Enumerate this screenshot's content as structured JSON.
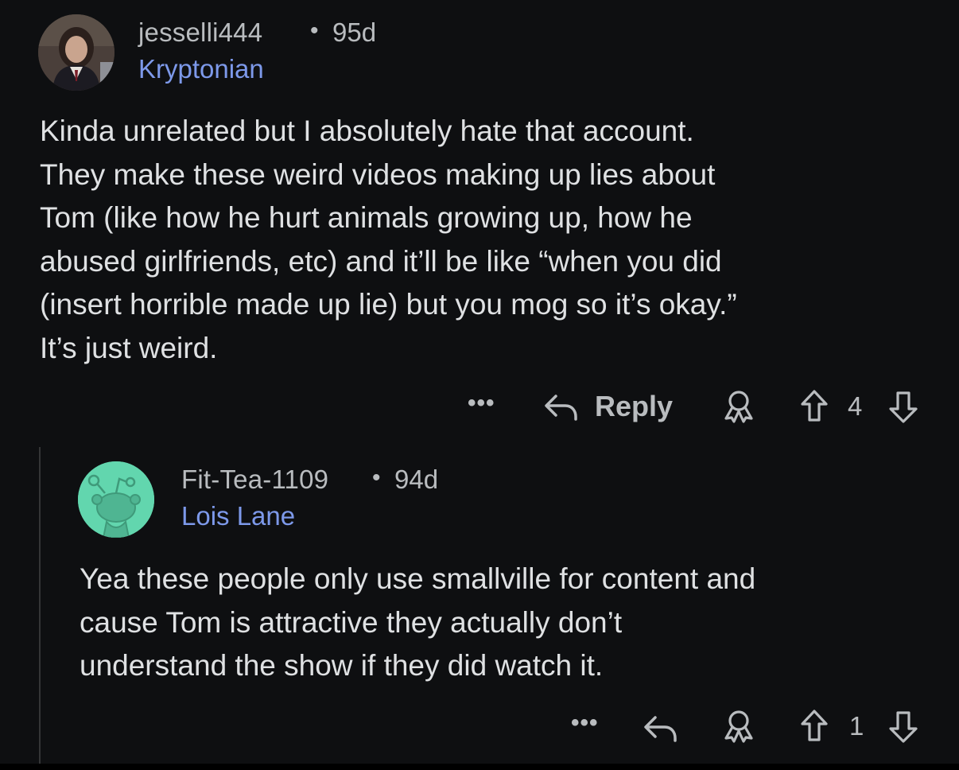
{
  "comments": [
    {
      "username": "jesselli444",
      "separator": "•",
      "age": "95d",
      "flair": "Kryptonian",
      "avatar_icon": "user-photo-avatar",
      "body_lines": [
        "Kinda unrelated but I absolutely hate that account.",
        "They make these weird videos making up lies about",
        "Tom (like how he hurt animals growing up, how he",
        "abused girlfriends, etc) and it’ll be like “when you did",
        "(insert horrible made up lie) but you mog so it’s okay.”",
        "It’s just weird."
      ],
      "actions": {
        "more_label": "•••",
        "reply_label": "Reply",
        "score": "4"
      }
    },
    {
      "username": "Fit-Tea-1109",
      "separator": "•",
      "age": "94d",
      "flair": "Lois Lane",
      "avatar_icon": "snoo-avatar",
      "avatar_color": "#62d6ae",
      "body_lines": [
        "Yea these people only use smallville for content and",
        "cause Tom is attractive they actually don’t",
        "understand the show if they did watch it."
      ],
      "actions": {
        "more_label": "•••",
        "score": "1"
      }
    }
  ],
  "colors": {
    "background": "#0e0f11",
    "text": "#dfe1e3",
    "meta": "#b9bcbf",
    "flair": "#7d99ea",
    "thread_line": "#343536"
  }
}
